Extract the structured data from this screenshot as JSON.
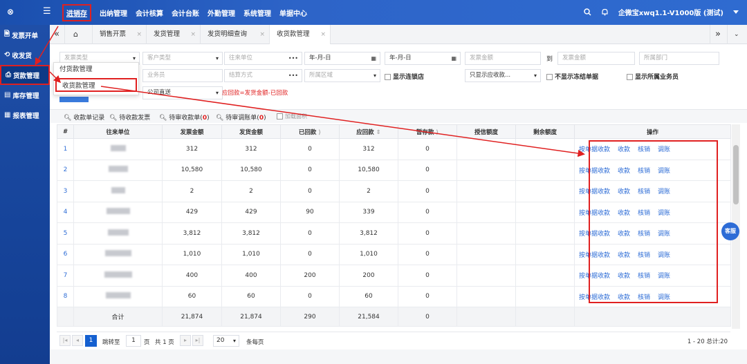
{
  "topbar": {
    "logo": "⊗",
    "menu_icon": "☰",
    "nav": [
      "进销存",
      "出纳管理",
      "会计核算",
      "会计台账",
      "外勤管理",
      "系统管理",
      "单据中心"
    ],
    "company": "企微宝xwq1.1-V1000版 (测试)"
  },
  "sidebar": [
    {
      "icon": "🗎",
      "label": "发票开单"
    },
    {
      "icon": "⟲",
      "label": "收发货"
    },
    {
      "icon": "⎙",
      "label": "货款管理"
    },
    {
      "icon": "▤",
      "label": "库存管理"
    },
    {
      "icon": "▦",
      "label": "报表管理"
    }
  ],
  "tabs": [
    "销售开票",
    "发货管理",
    "发货明细查询",
    "收货款管理"
  ],
  "filters": {
    "invoice_type": "发票类型",
    "customer_type": "客户类型",
    "partner": "往来单位",
    "date_from": "年-月-日",
    "date_to": "年-月-日",
    "amount_from": "发票金额",
    "to_label": "到",
    "amount_to": "发票金额",
    "department": "所属部门",
    "salesperson": "业务员",
    "settle_method": "结算方式",
    "region": "所属区域",
    "chain_label": "显示连锁店",
    "receivable_only": "只显示应收款...",
    "no_frozen": "不显示冻结单据",
    "show_salesperson": "显示所属业务员",
    "company": "公司直送",
    "formula": "应回款=发货金额-已回款"
  },
  "dropdown": [
    "付货款管理",
    "收货款管理"
  ],
  "quick": {
    "a": "收款单记录",
    "b": "待收款发票",
    "c_prefix": "待审收款单(",
    "c_count": "0",
    "c_suffix": ")",
    "d_prefix": "待审调账单(",
    "d_count": "0",
    "d_suffix": ")",
    "e": "加载面积"
  },
  "columns": [
    "#",
    "往来单位",
    "发票金额",
    "发货金额",
    "已回款",
    "应回款",
    "暂存款",
    "授信额度",
    "剩余额度",
    "操作"
  ],
  "rows": [
    {
      "n": "1",
      "inv": "312",
      "ship": "312",
      "paid": "0",
      "due": "312",
      "tmp": "0"
    },
    {
      "n": "2",
      "inv": "10,580",
      "ship": "10,580",
      "paid": "0",
      "due": "10,580",
      "tmp": "0"
    },
    {
      "n": "3",
      "inv": "2",
      "ship": "2",
      "paid": "0",
      "due": "2",
      "tmp": "0"
    },
    {
      "n": "4",
      "inv": "429",
      "ship": "429",
      "paid": "90",
      "due": "339",
      "tmp": "0"
    },
    {
      "n": "5",
      "inv": "3,812",
      "ship": "3,812",
      "paid": "0",
      "due": "3,812",
      "tmp": "0"
    },
    {
      "n": "6",
      "inv": "1,010",
      "ship": "1,010",
      "paid": "0",
      "due": "1,010",
      "tmp": "0"
    },
    {
      "n": "7",
      "inv": "400",
      "ship": "400",
      "paid": "200",
      "due": "200",
      "tmp": "0"
    },
    {
      "n": "8",
      "inv": "60",
      "ship": "60",
      "paid": "0",
      "due": "60",
      "tmp": "0"
    }
  ],
  "ops": [
    "按单据收款",
    "收款",
    "核销",
    "调账"
  ],
  "total": {
    "label": "合计",
    "inv": "21,874",
    "ship": "21,874",
    "paid": "290",
    "due": "21,584",
    "tmp": "0"
  },
  "pager": {
    "page": "1",
    "goto": "跳转至",
    "goto_val": "1",
    "page_unit": "页",
    "total_pages": "共 1 页",
    "size": "20",
    "size_unit": "条每页",
    "summary": "1 - 20 总计:20"
  },
  "service": "客服",
  "colors": {
    "accent": "#e02020",
    "link": "#2d6cd6",
    "brand": "#1a4fae"
  }
}
